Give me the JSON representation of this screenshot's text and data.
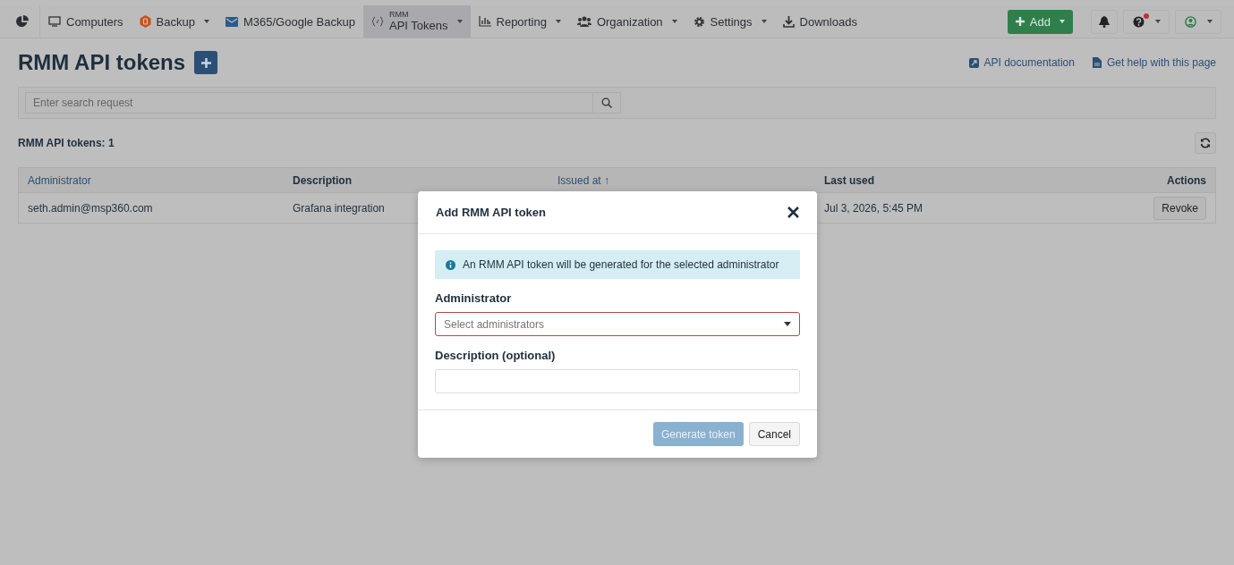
{
  "nav": {
    "items": [
      {
        "label": "Computers",
        "dropdown": false,
        "selected": false
      },
      {
        "label": "Backup",
        "dropdown": true,
        "selected": false
      },
      {
        "label": "M365/Google Backup",
        "dropdown": false,
        "selected": false
      },
      {
        "overline": "RMM",
        "label": "API Tokens",
        "dropdown": true,
        "selected": true
      },
      {
        "label": "Reporting",
        "dropdown": true,
        "selected": false
      },
      {
        "label": "Organization",
        "dropdown": true,
        "selected": false
      },
      {
        "label": "Settings",
        "dropdown": true,
        "selected": false
      },
      {
        "label": "Downloads",
        "dropdown": false,
        "selected": false
      }
    ],
    "add_button": "Add",
    "help_has_alert": true
  },
  "page": {
    "title": "RMM API tokens",
    "links": [
      "API documentation",
      "Get help with this page"
    ],
    "search": {
      "placeholder": "Enter search request"
    },
    "count": "RMM API tokens: 1"
  },
  "table": {
    "columns": [
      {
        "label": "Administrator",
        "sortable": true
      },
      {
        "label": "Description",
        "sortable": false
      },
      {
        "label": "Issued at ↑",
        "sortable": true
      },
      {
        "label": "Last used",
        "sortable": false
      },
      {
        "label": "Actions",
        "sortable": false
      }
    ],
    "rows": [
      {
        "administrator": "seth.admin@msp360.com",
        "description": "Grafana integration",
        "last_used": "Jul 3, 2026, 5:45 PM",
        "action": "Revoke"
      }
    ]
  },
  "modal": {
    "title": "Add RMM API token",
    "info": "An RMM API token will be generated for the selected administrator",
    "fields": [
      {
        "kind": "select",
        "label": "Administrator",
        "placeholder": "Select administrators",
        "invalid": true
      },
      {
        "kind": "text",
        "label": "Description (optional)",
        "invalid": false
      }
    ],
    "buttons": [
      {
        "kind": "primary",
        "label": "Generate token",
        "disabled": true
      },
      {
        "kind": "secondary",
        "label": "Cancel",
        "disabled": false
      }
    ]
  }
}
